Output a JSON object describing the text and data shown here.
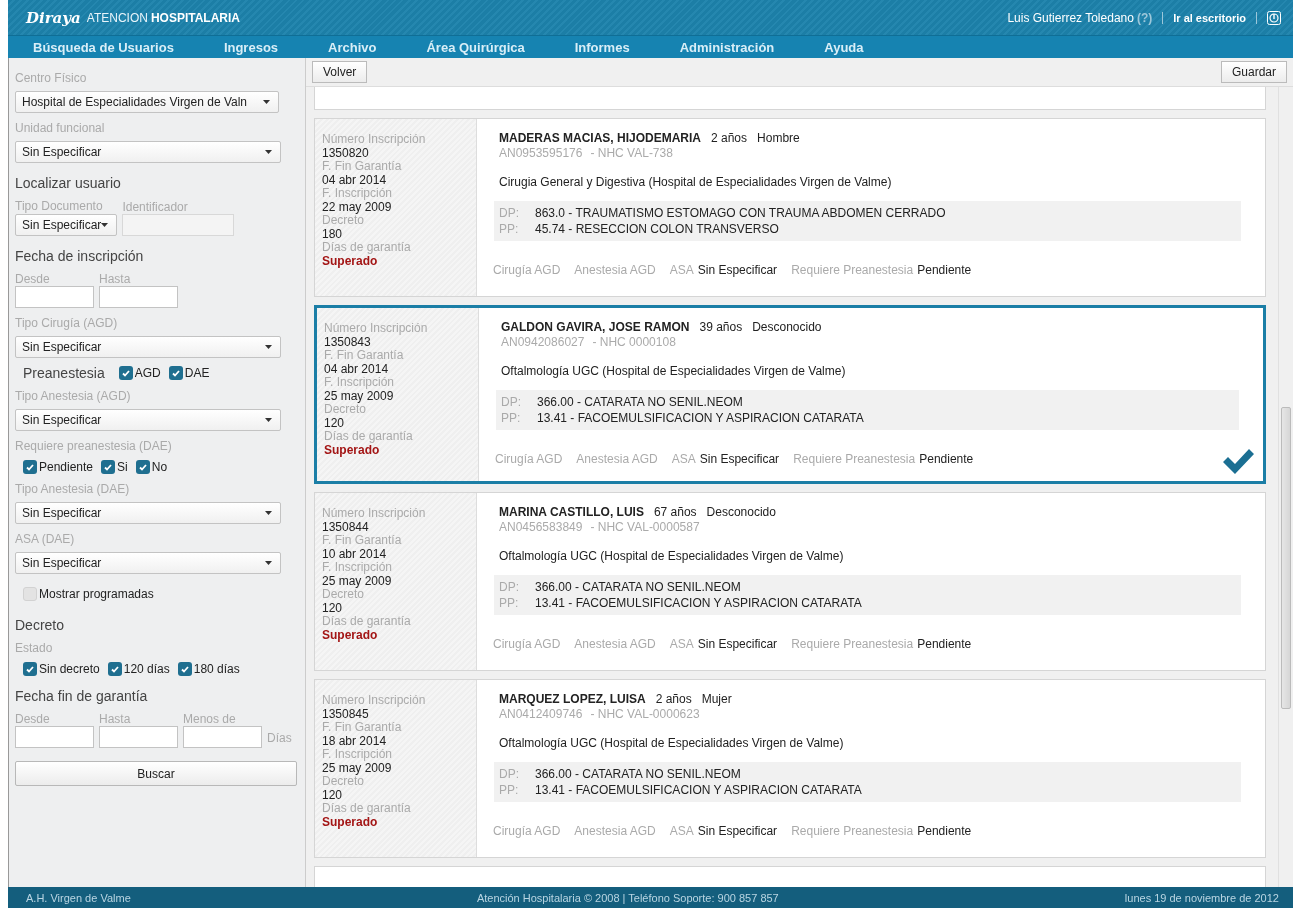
{
  "header": {
    "logo": "Diraya",
    "title_light": "ATENCION",
    "title_bold": "HOSPITALARIA",
    "user": "Luis Gutierrez Toledano",
    "help": "(?)",
    "desktop_link": "Ir al escritorio"
  },
  "nav": [
    "Búsqueda de Usuarios",
    "Ingresos",
    "Archivo",
    "Área Quirúrgica",
    "Informes",
    "Administración",
    "Ayuda"
  ],
  "filters": [
    {
      "kind": "select",
      "label": "Centro Físico",
      "value": "Hospital de Especialidades Virgen de Valn"
    },
    {
      "kind": "select",
      "label": "Unidad funcional",
      "value": "Sin Especificar"
    },
    {
      "kind": "heading",
      "text": "Localizar usuario"
    },
    {
      "kind": "fields",
      "fields": [
        {
          "kind": "select",
          "label": "Tipo Documento",
          "value": "Sin Especificar"
        },
        {
          "kind": "input",
          "label": "Identificador",
          "disabled": true
        }
      ]
    },
    {
      "kind": "heading",
      "text": "Fecha de inscripción"
    },
    {
      "kind": "fields",
      "fields": [
        {
          "kind": "input",
          "label": "Desde",
          "disabled": false
        },
        {
          "kind": "input",
          "label": "Hasta",
          "disabled": false
        }
      ]
    },
    {
      "kind": "select",
      "label": "Tipo Cirugía (AGD)",
      "value": "Sin Especificar"
    },
    {
      "kind": "checks",
      "title": "Preanestesia",
      "options": [
        {
          "label": "AGD",
          "checked": true
        },
        {
          "label": "DAE",
          "checked": true
        }
      ]
    },
    {
      "kind": "select",
      "label": "Tipo Anestesia (AGD)",
      "value": "Sin Especificar"
    },
    {
      "kind": "checks",
      "label": "Requiere preanestesia (DAE)",
      "options": [
        {
          "label": "Pendiente",
          "checked": true
        },
        {
          "label": "Si",
          "checked": true
        },
        {
          "label": "No",
          "checked": true
        }
      ]
    },
    {
      "kind": "select",
      "label": "Tipo Anestesia (DAE)",
      "value": "Sin Especificar"
    },
    {
      "kind": "select",
      "label": "ASA (DAE)",
      "value": "Sin Especificar"
    },
    {
      "kind": "checks",
      "options": [
        {
          "label": "Mostrar programadas",
          "checked": false
        }
      ]
    },
    {
      "kind": "heading",
      "text": "Decreto"
    },
    {
      "kind": "checks",
      "label": "Estado",
      "options": [
        {
          "label": "Sin decreto",
          "checked": true
        },
        {
          "label": "120 días",
          "checked": true
        },
        {
          "label": "180 días",
          "checked": true
        }
      ]
    },
    {
      "kind": "heading",
      "text": "Fecha fin de garantía"
    },
    {
      "kind": "fields",
      "fields": [
        {
          "kind": "input",
          "label": "Desde",
          "disabled": false
        },
        {
          "kind": "input",
          "label": "Hasta",
          "disabled": false
        },
        {
          "kind": "input",
          "label": "Menos de",
          "suffix": "Días",
          "disabled": false
        }
      ]
    },
    {
      "kind": "button",
      "text": "Buscar"
    }
  ],
  "toolbar": {
    "back": "Volver",
    "save": "Guardar"
  },
  "cards": [
    {
      "selected": false,
      "fields": [
        {
          "label": "Número Inscripción",
          "value": "1350820",
          "alert": false
        },
        {
          "label": "F. Fin Garantía",
          "value": "04 abr 2014",
          "alert": false
        },
        {
          "label": "F. Inscripción",
          "value": "22 may 2009",
          "alert": false
        },
        {
          "label": "Decreto",
          "value": "180",
          "alert": false
        },
        {
          "label": "Días de garantía",
          "value": "Superado",
          "alert": true
        }
      ],
      "name": "MADERAS MACIAS, HIJODEMARIA",
      "age": "2 años",
      "sex": "Hombre",
      "id": "AN0953595176",
      "nhc": "- NHC VAL-738",
      "service": "Cirugia General y Digestiva (Hospital de Especialidades Virgen de Valme)",
      "procedures": [
        {
          "label": "DP:",
          "value": "863.0 - TRAUMATISMO ESTOMAGO CON TRAUMA ABDOMEN CERRADO"
        },
        {
          "label": "PP:",
          "value": "45.74 - RESECCION COLON TRANSVERSO"
        }
      ],
      "status": [
        {
          "label": "Cirugía AGD"
        },
        {
          "label": "Anestesia AGD"
        },
        {
          "label": "ASA",
          "value": "Sin Especificar"
        },
        {
          "label": "Requiere Preanestesia",
          "value": "Pendiente"
        }
      ]
    },
    {
      "selected": true,
      "fields": [
        {
          "label": "Número Inscripción",
          "value": "1350843",
          "alert": false
        },
        {
          "label": "F. Fin Garantía",
          "value": "04 abr 2014",
          "alert": false
        },
        {
          "label": "F. Inscripción",
          "value": "25 may 2009",
          "alert": false
        },
        {
          "label": "Decreto",
          "value": "120",
          "alert": false
        },
        {
          "label": "Días de garantía",
          "value": "Superado",
          "alert": true
        }
      ],
      "name": "GALDON GAVIRA, JOSE RAMON",
      "age": "39 años",
      "sex": "Desconocido",
      "id": "AN0942086027",
      "nhc": "- NHC 0000108",
      "service": "Oftalmología UGC (Hospital de Especialidades Virgen de Valme)",
      "procedures": [
        {
          "label": "DP:",
          "value": "366.00 - CATARATA NO SENIL.NEOM"
        },
        {
          "label": "PP:",
          "value": "13.41 - FACOEMULSIFICACION Y ASPIRACION CATARATA"
        }
      ],
      "status": [
        {
          "label": "Cirugía AGD"
        },
        {
          "label": "Anestesia AGD"
        },
        {
          "label": "ASA",
          "value": "Sin Especificar"
        },
        {
          "label": "Requiere Preanestesia",
          "value": "Pendiente"
        }
      ]
    },
    {
      "selected": false,
      "fields": [
        {
          "label": "Número Inscripción",
          "value": "1350844",
          "alert": false
        },
        {
          "label": "F. Fin Garantía",
          "value": "10 abr 2014",
          "alert": false
        },
        {
          "label": "F. Inscripción",
          "value": "25 may 2009",
          "alert": false
        },
        {
          "label": "Decreto",
          "value": "120",
          "alert": false
        },
        {
          "label": "Días de garantía",
          "value": "Superado",
          "alert": true
        }
      ],
      "name": "MARINA CASTILLO, LUIS",
      "age": "67 años",
      "sex": "Desconocido",
      "id": "AN0456583849",
      "nhc": "- NHC VAL-0000587",
      "service": "Oftalmología UGC (Hospital de Especialidades Virgen de Valme)",
      "procedures": [
        {
          "label": "DP:",
          "value": "366.00 - CATARATA NO SENIL.NEOM"
        },
        {
          "label": "PP:",
          "value": "13.41 - FACOEMULSIFICACION Y ASPIRACION CATARATA"
        }
      ],
      "status": [
        {
          "label": "Cirugía AGD"
        },
        {
          "label": "Anestesia AGD"
        },
        {
          "label": "ASA",
          "value": "Sin Especificar"
        },
        {
          "label": "Requiere Preanestesia",
          "value": "Pendiente"
        }
      ]
    },
    {
      "selected": false,
      "fields": [
        {
          "label": "Número Inscripción",
          "value": "1350845",
          "alert": false
        },
        {
          "label": "F. Fin Garantía",
          "value": "18 abr 2014",
          "alert": false
        },
        {
          "label": "F. Inscripción",
          "value": "25 may 2009",
          "alert": false
        },
        {
          "label": "Decreto",
          "value": "120",
          "alert": false
        },
        {
          "label": "Días de garantía",
          "value": "Superado",
          "alert": true
        }
      ],
      "name": "MARQUEZ LOPEZ, LUISA",
      "age": "2 años",
      "sex": "Mujer",
      "id": "AN0412409746",
      "nhc": "- NHC VAL-0000623",
      "service": "Oftalmología UGC (Hospital de Especialidades Virgen de Valme)",
      "procedures": [
        {
          "label": "DP:",
          "value": "366.00 - CATARATA NO SENIL.NEOM"
        },
        {
          "label": "PP:",
          "value": "13.41 - FACOEMULSIFICACION Y ASPIRACION CATARATA"
        }
      ],
      "status": [
        {
          "label": "Cirugía AGD"
        },
        {
          "label": "Anestesia AGD"
        },
        {
          "label": "ASA",
          "value": "Sin Especificar"
        },
        {
          "label": "Requiere Preanestesia",
          "value": "Pendiente"
        }
      ]
    }
  ],
  "footer": {
    "left": "A.H. Virgen de Valme",
    "center": "Atención Hospitalaria © 2008 | Teléfono Soporte: 900 857 857",
    "right": "lunes 19 de noviembre de 2012"
  }
}
